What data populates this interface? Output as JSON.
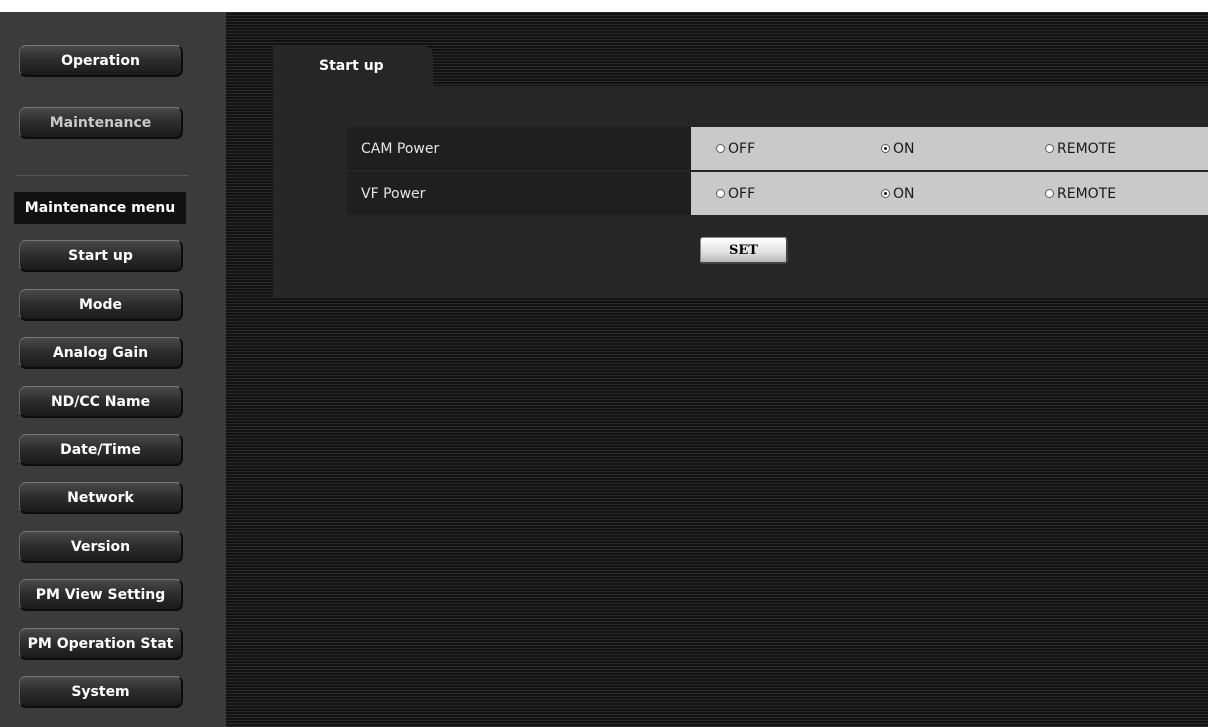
{
  "sidebar": {
    "top_buttons": [
      {
        "label": "Operation"
      },
      {
        "label": "Maintenance"
      }
    ],
    "menu_heading": "Maintenance menu",
    "menu_items": [
      {
        "label": "Start up"
      },
      {
        "label": "Mode"
      },
      {
        "label": "Analog Gain"
      },
      {
        "label": "ND/CC Name"
      },
      {
        "label": "Date/Time"
      },
      {
        "label": "Network"
      },
      {
        "label": "Version"
      },
      {
        "label": "PM View Setting"
      },
      {
        "label": "PM Operation Stat"
      },
      {
        "label": "System"
      }
    ]
  },
  "main": {
    "tab_label": "Start up",
    "settings": [
      {
        "label": "CAM Power",
        "options": [
          {
            "label": "OFF",
            "selected": false
          },
          {
            "label": "ON",
            "selected": true
          },
          {
            "label": "REMOTE",
            "selected": false
          }
        ]
      },
      {
        "label": "VF Power",
        "options": [
          {
            "label": "OFF",
            "selected": false
          },
          {
            "label": "ON",
            "selected": true
          },
          {
            "label": "REMOTE",
            "selected": false
          }
        ]
      }
    ],
    "set_button": "SET"
  }
}
